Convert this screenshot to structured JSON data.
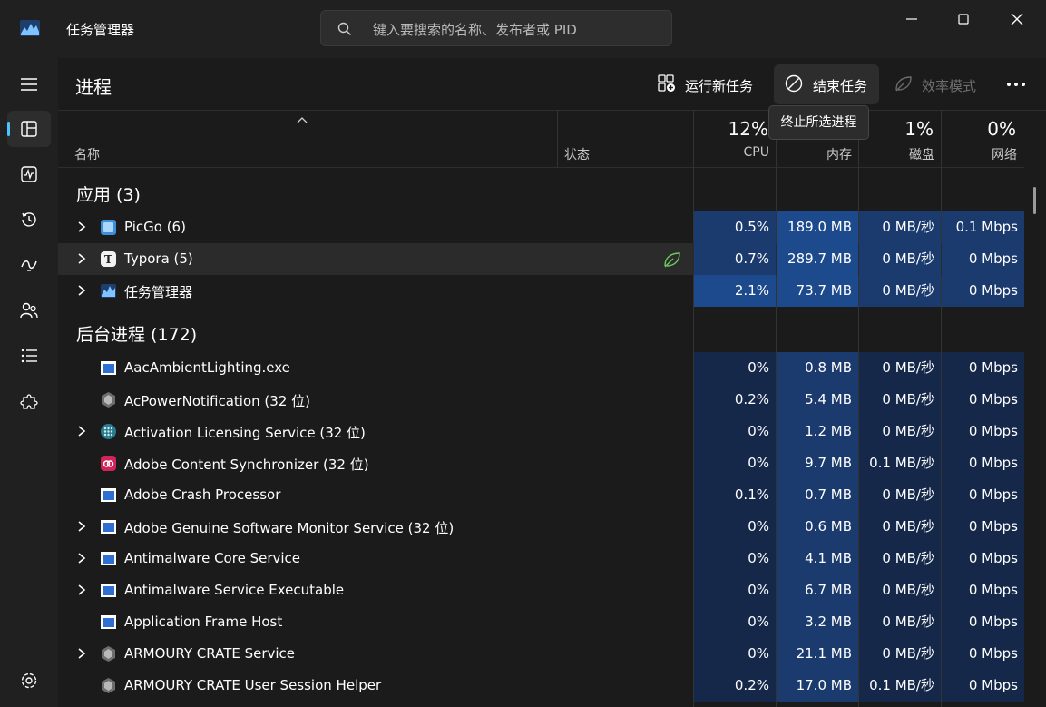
{
  "window": {
    "title": "任务管理器"
  },
  "search": {
    "placeholder": "键入要搜索的名称、发布者或 PID"
  },
  "page": {
    "title": "进程"
  },
  "toolbar": {
    "run_new_task": "运行新任务",
    "end_task": "结束任务",
    "efficiency_mode": "效率模式",
    "tooltip": "终止所选进程"
  },
  "columns": {
    "name": "名称",
    "status": "状态",
    "cpu": {
      "label": "CPU",
      "percent": "12%"
    },
    "memory": {
      "label": "内存",
      "percent": ""
    },
    "disk": {
      "label": "磁盘",
      "percent": "1%"
    },
    "network": {
      "label": "网络",
      "percent": "0%"
    }
  },
  "groups": [
    {
      "label": "应用 (3)"
    },
    {
      "label": "后台进程 (172)"
    }
  ],
  "apps": [
    {
      "name": "PicGo (6)",
      "icon": "picgo-icon",
      "expandable": true,
      "cpu": "0.5%",
      "mem": "189.0 MB",
      "disk": "0 MB/秒",
      "net": "0.1 Mbps",
      "efficiency": false
    },
    {
      "name": "Typora (5)",
      "icon": "typora-icon",
      "expandable": true,
      "cpu": "0.7%",
      "mem": "289.7 MB",
      "disk": "0 MB/秒",
      "net": "0 Mbps",
      "efficiency": true
    },
    {
      "name": "任务管理器",
      "icon": "task-manager-icon",
      "expandable": true,
      "cpu": "2.1%",
      "mem": "73.7 MB",
      "disk": "0 MB/秒",
      "net": "0 Mbps",
      "efficiency": false
    }
  ],
  "background": [
    {
      "name": "AacAmbientLighting.exe",
      "icon": "window-app-icon",
      "expandable": false,
      "cpu": "0%",
      "mem": "0.8 MB",
      "disk": "0 MB/秒",
      "net": "0 Mbps"
    },
    {
      "name": "AcPowerNotification (32 位)",
      "icon": "armoury-icon",
      "expandable": false,
      "cpu": "0.2%",
      "mem": "5.4 MB",
      "disk": "0 MB/秒",
      "net": "0 Mbps"
    },
    {
      "name": "Activation Licensing Service (32 位)",
      "icon": "globe-icon",
      "expandable": true,
      "cpu": "0%",
      "mem": "1.2 MB",
      "disk": "0 MB/秒",
      "net": "0 Mbps"
    },
    {
      "name": "Adobe Content Synchronizer (32 位)",
      "icon": "adobe-cc-icon",
      "expandable": false,
      "cpu": "0%",
      "mem": "9.7 MB",
      "disk": "0.1 MB/秒",
      "net": "0 Mbps"
    },
    {
      "name": "Adobe Crash Processor",
      "icon": "window-app-icon",
      "expandable": false,
      "cpu": "0.1%",
      "mem": "0.7 MB",
      "disk": "0 MB/秒",
      "net": "0 Mbps"
    },
    {
      "name": "Adobe Genuine Software Monitor Service (32 位)",
      "icon": "window-app-icon",
      "expandable": true,
      "cpu": "0%",
      "mem": "0.6 MB",
      "disk": "0 MB/秒",
      "net": "0 Mbps"
    },
    {
      "name": "Antimalware Core Service",
      "icon": "window-app-icon",
      "expandable": true,
      "cpu": "0%",
      "mem": "4.1 MB",
      "disk": "0 MB/秒",
      "net": "0 Mbps"
    },
    {
      "name": "Antimalware Service Executable",
      "icon": "window-app-icon",
      "expandable": true,
      "cpu": "0%",
      "mem": "6.7 MB",
      "disk": "0 MB/秒",
      "net": "0 Mbps"
    },
    {
      "name": "Application Frame Host",
      "icon": "window-app-icon",
      "expandable": false,
      "cpu": "0%",
      "mem": "3.2 MB",
      "disk": "0 MB/秒",
      "net": "0 Mbps"
    },
    {
      "name": "ARMOURY CRATE Service",
      "icon": "armoury-icon",
      "expandable": true,
      "cpu": "0%",
      "mem": "21.1 MB",
      "disk": "0 MB/秒",
      "net": "0 Mbps"
    },
    {
      "name": "ARMOURY CRATE User Session Helper",
      "icon": "armoury-icon",
      "expandable": false,
      "cpu": "0.2%",
      "mem": "17.0 MB",
      "disk": "0.1 MB/秒",
      "net": "0 Mbps"
    }
  ],
  "colors": {
    "accent": "#4cc2ff",
    "heat_low": "#15284a",
    "heat_mid": "#1b3a6e",
    "heat_high": "#1c4a8c",
    "background": "#1b1b1b"
  }
}
